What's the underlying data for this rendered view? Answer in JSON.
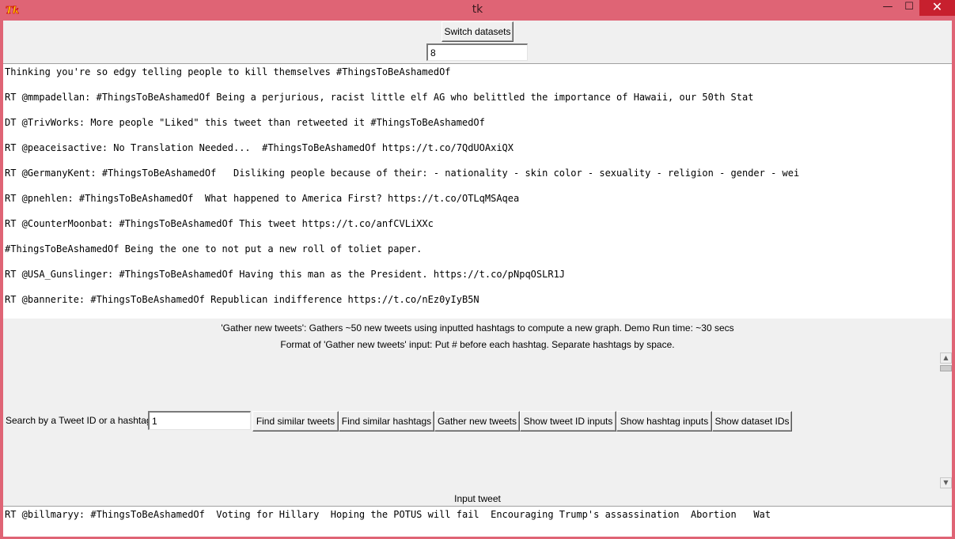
{
  "window": {
    "title": "tk",
    "minimize_glyph": "—",
    "maximize_glyph": "☐",
    "close_glyph": "✕"
  },
  "top": {
    "switch_datasets_label": "Switch datasets",
    "dataset_value": "8"
  },
  "tweets": [
    "Thinking you're so edgy telling people to kill themselves #ThingsToBeAshamedOf",
    "RT @mmpadellan: #ThingsToBeAshamedOf Being a perjurious, racist little elf AG who belittled the importance of Hawaii, our 50th Stat",
    "DT @TrivWorks: More people \"Liked\" this tweet than retweeted it #ThingsToBeAshamedOf",
    "RT @peaceisactive: No Translation Needed...  #ThingsToBeAshamedOf https://t.co/7QdUOAxiQX",
    "RT @GermanyKent: #ThingsToBeAshamedOf   Disliking people because of their: - nationality - skin color - sexuality - religion - gender - wei",
    "RT @pnehlen: #ThingsToBeAshamedOf  What happened to America First? https://t.co/OTLqMSAqea",
    "RT @CounterMoonbat: #ThingsToBeAshamedOf This tweet https://t.co/anfCVLiXXc",
    "#ThingsToBeAshamedOf Being the one to not put a new roll of toliet paper.",
    "RT @USA_Gunslinger: #ThingsToBeAshamedOf Having this man as the President. https://t.co/pNpqOSLR1J",
    "RT @bannerite: #ThingsToBeAshamedOf Republican indifference https://t.co/nEz0yIyB5N"
  ],
  "info": {
    "line1": "'Gather new tweets': Gathers ~50 new tweets using inputted hashtags to compute a new graph. Demo Run time: ~30 secs",
    "line2": "Format of 'Gather new tweets' input: Put # before each hashtag. Separate hashtags by space."
  },
  "search": {
    "label": "Search by a Tweet ID or a hashtag",
    "value": "1",
    "buttons": {
      "find_tweets": "Find similar tweets",
      "find_hashtags": "Find similar hashtags",
      "gather": "Gather new tweets",
      "show_tweet_ids": "Show tweet ID inputs",
      "show_hashtags": "Show hashtag inputs",
      "show_datasets": "Show dataset IDs"
    }
  },
  "input_tweet": {
    "label": "Input tweet",
    "text": "RT @billmaryy: #ThingsToBeAshamedOf  Voting for Hillary  Hoping the POTUS will fail  Encouraging Trump's assassination  Abortion   Wat"
  },
  "icons": {
    "app": "tk-feather-icon",
    "scroll_up": "▲",
    "scroll_down": "▼"
  }
}
